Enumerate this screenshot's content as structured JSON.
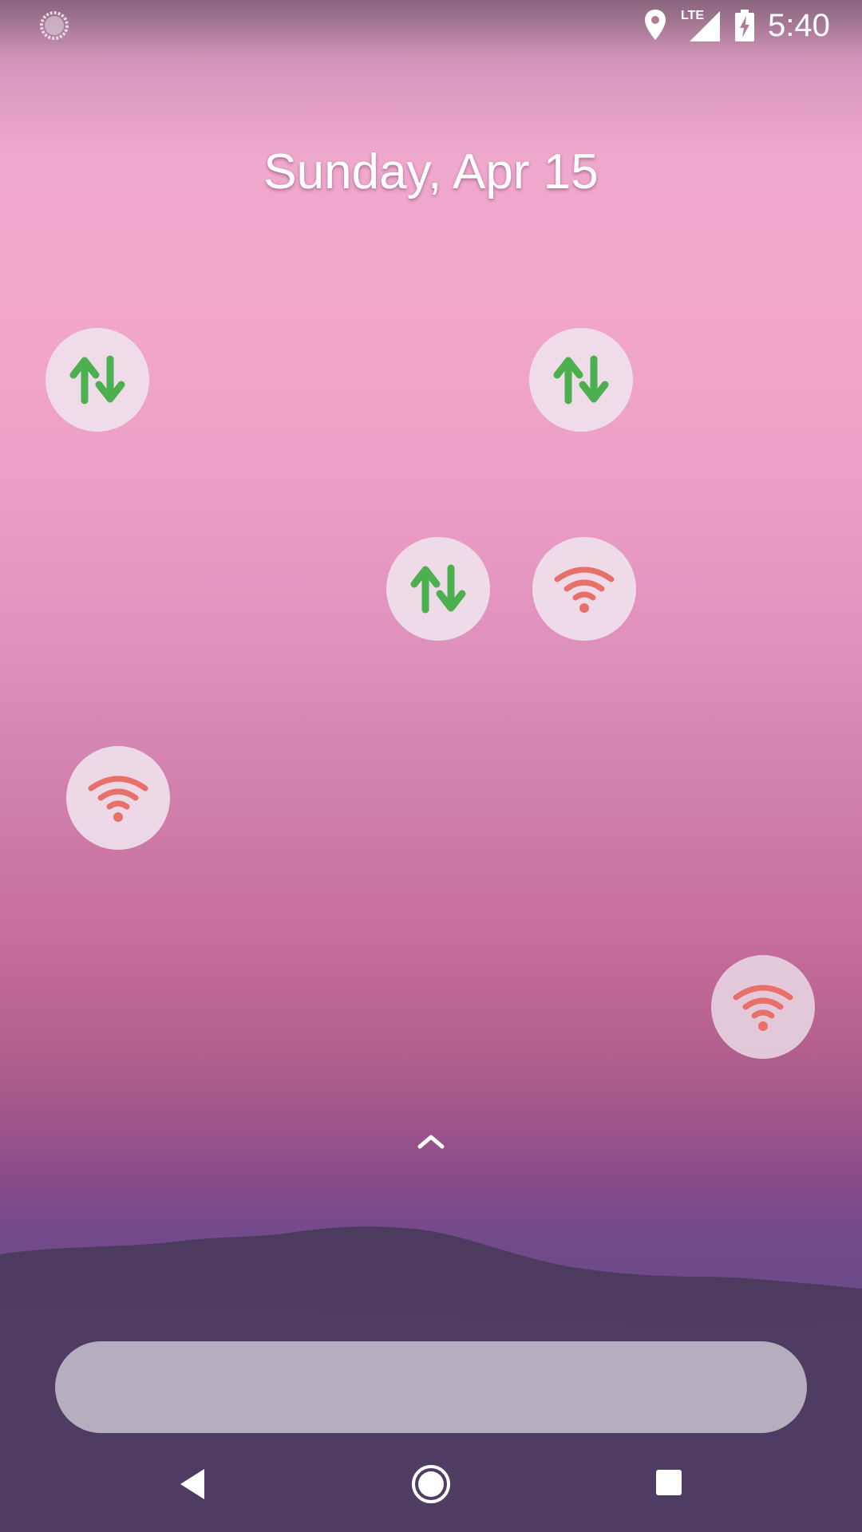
{
  "status_bar": {
    "time": "5:40",
    "network_type": "LTE",
    "icons": [
      "sync-icon",
      "location-icon",
      "signal-icon",
      "battery-charging-icon"
    ]
  },
  "lockscreen": {
    "date": "Sunday, Apr 15"
  },
  "bubbles": [
    {
      "icon": "data-transfer-icon",
      "color": "#4caf50"
    },
    {
      "icon": "data-transfer-icon",
      "color": "#4caf50"
    },
    {
      "icon": "data-transfer-icon",
      "color": "#4caf50"
    },
    {
      "icon": "wifi-icon",
      "color": "#e8706a"
    },
    {
      "icon": "wifi-icon",
      "color": "#e8706a"
    },
    {
      "icon": "wifi-icon",
      "color": "#e8706a"
    }
  ],
  "swipe_hint": {
    "icon": "chevron-up-icon"
  },
  "search_bar": {
    "placeholder": ""
  },
  "nav_bar": {
    "buttons": [
      "back-icon",
      "home-icon",
      "recents-icon"
    ]
  },
  "colors": {
    "data_icon": "#4caf50",
    "wifi_icon": "#e8706a",
    "bubble_bg": "#f0e2ec",
    "search_bar_bg": "#beb8c6"
  }
}
